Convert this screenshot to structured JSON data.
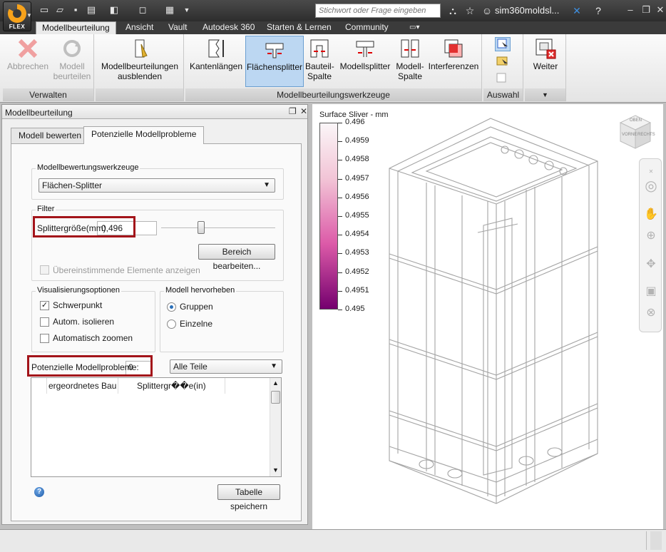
{
  "app": {
    "badge": "FLEX"
  },
  "search": {
    "placeholder": "Stichwort oder Frage eingeben"
  },
  "user": {
    "name": "sim360moldsl..."
  },
  "ribbon_tabs": [
    "Modellbeurteilung",
    "Ansicht",
    "Vault",
    "Autodesk 360",
    "Starten & Lernen",
    "Community"
  ],
  "ribbon": {
    "verwalten": {
      "label": "Verwalten",
      "abbrechen": "Abbrechen",
      "modell": "Modell",
      "beurteilen": "beurteilen"
    },
    "ausblenden": {
      "line1": "Modellbeurteilungen",
      "line2": "ausblenden"
    },
    "werkzeuge": {
      "label": "Modellbeurteilungswerkzeuge",
      "kantenlaengen": "Kantenlängen",
      "flaechensplitter": "Flächensplitter",
      "bauteil": "Bauteil-",
      "spalte1": "Spalte",
      "modellsplitter": "Modellsplitter",
      "modell": "Modell-",
      "spalte2": "Spalte",
      "interferenzen": "Interferenzen"
    },
    "auswahl": {
      "label": "Auswahl"
    },
    "weiter": {
      "label": "Weiter"
    }
  },
  "panel": {
    "title": "Modellbeurteilung",
    "tabs": [
      "Modell bewerten",
      "Potenzielle Modellprobleme"
    ],
    "tools_group": "Modellbewertungswerkzeuge",
    "tool_selected": "Flächen-Splitter",
    "filter_group": "Filter",
    "splitter_label": "Splittergröße(mm)",
    "splitter_value": "0,496",
    "slider_position": 0.35,
    "edit_range_button": "Bereich bearbeiten...",
    "matching_label": "Übereinstimmende Elemente anzeigen",
    "vis_group": "Visualisierungsoptionen",
    "vis_options": [
      {
        "label": "Schwerpunkt",
        "checked": true
      },
      {
        "label": "Autom. isolieren",
        "checked": false
      },
      {
        "label": "Automatisch zoomen",
        "checked": false
      }
    ],
    "highlight_group": "Modell hervorheben",
    "highlight_options": [
      {
        "label": "Gruppen",
        "selected": true
      },
      {
        "label": "Einzelne",
        "selected": false
      }
    ],
    "problems_label": "Potenzielle Modellprobleme:",
    "problems_value": "0",
    "parts_filter": "Alle Teile",
    "grid_columns": [
      "ergeordnetes Bau",
      "Splittergr��e(in)"
    ],
    "save_button": "Tabelle speichern"
  },
  "legend": {
    "title": "Surface Sliver - mm",
    "values": [
      "0.496",
      "0.4959",
      "0.4958",
      "0.4957",
      "0.4956",
      "0.4955",
      "0.4954",
      "0.4953",
      "0.4952",
      "0.4951",
      "0.495"
    ],
    "color_top": "#fbf6f8",
    "color_bottom": "#74006e"
  },
  "viewcube": {
    "face_top": "OBEN",
    "face_front": "VORNE",
    "face_right": "RECHTS"
  }
}
